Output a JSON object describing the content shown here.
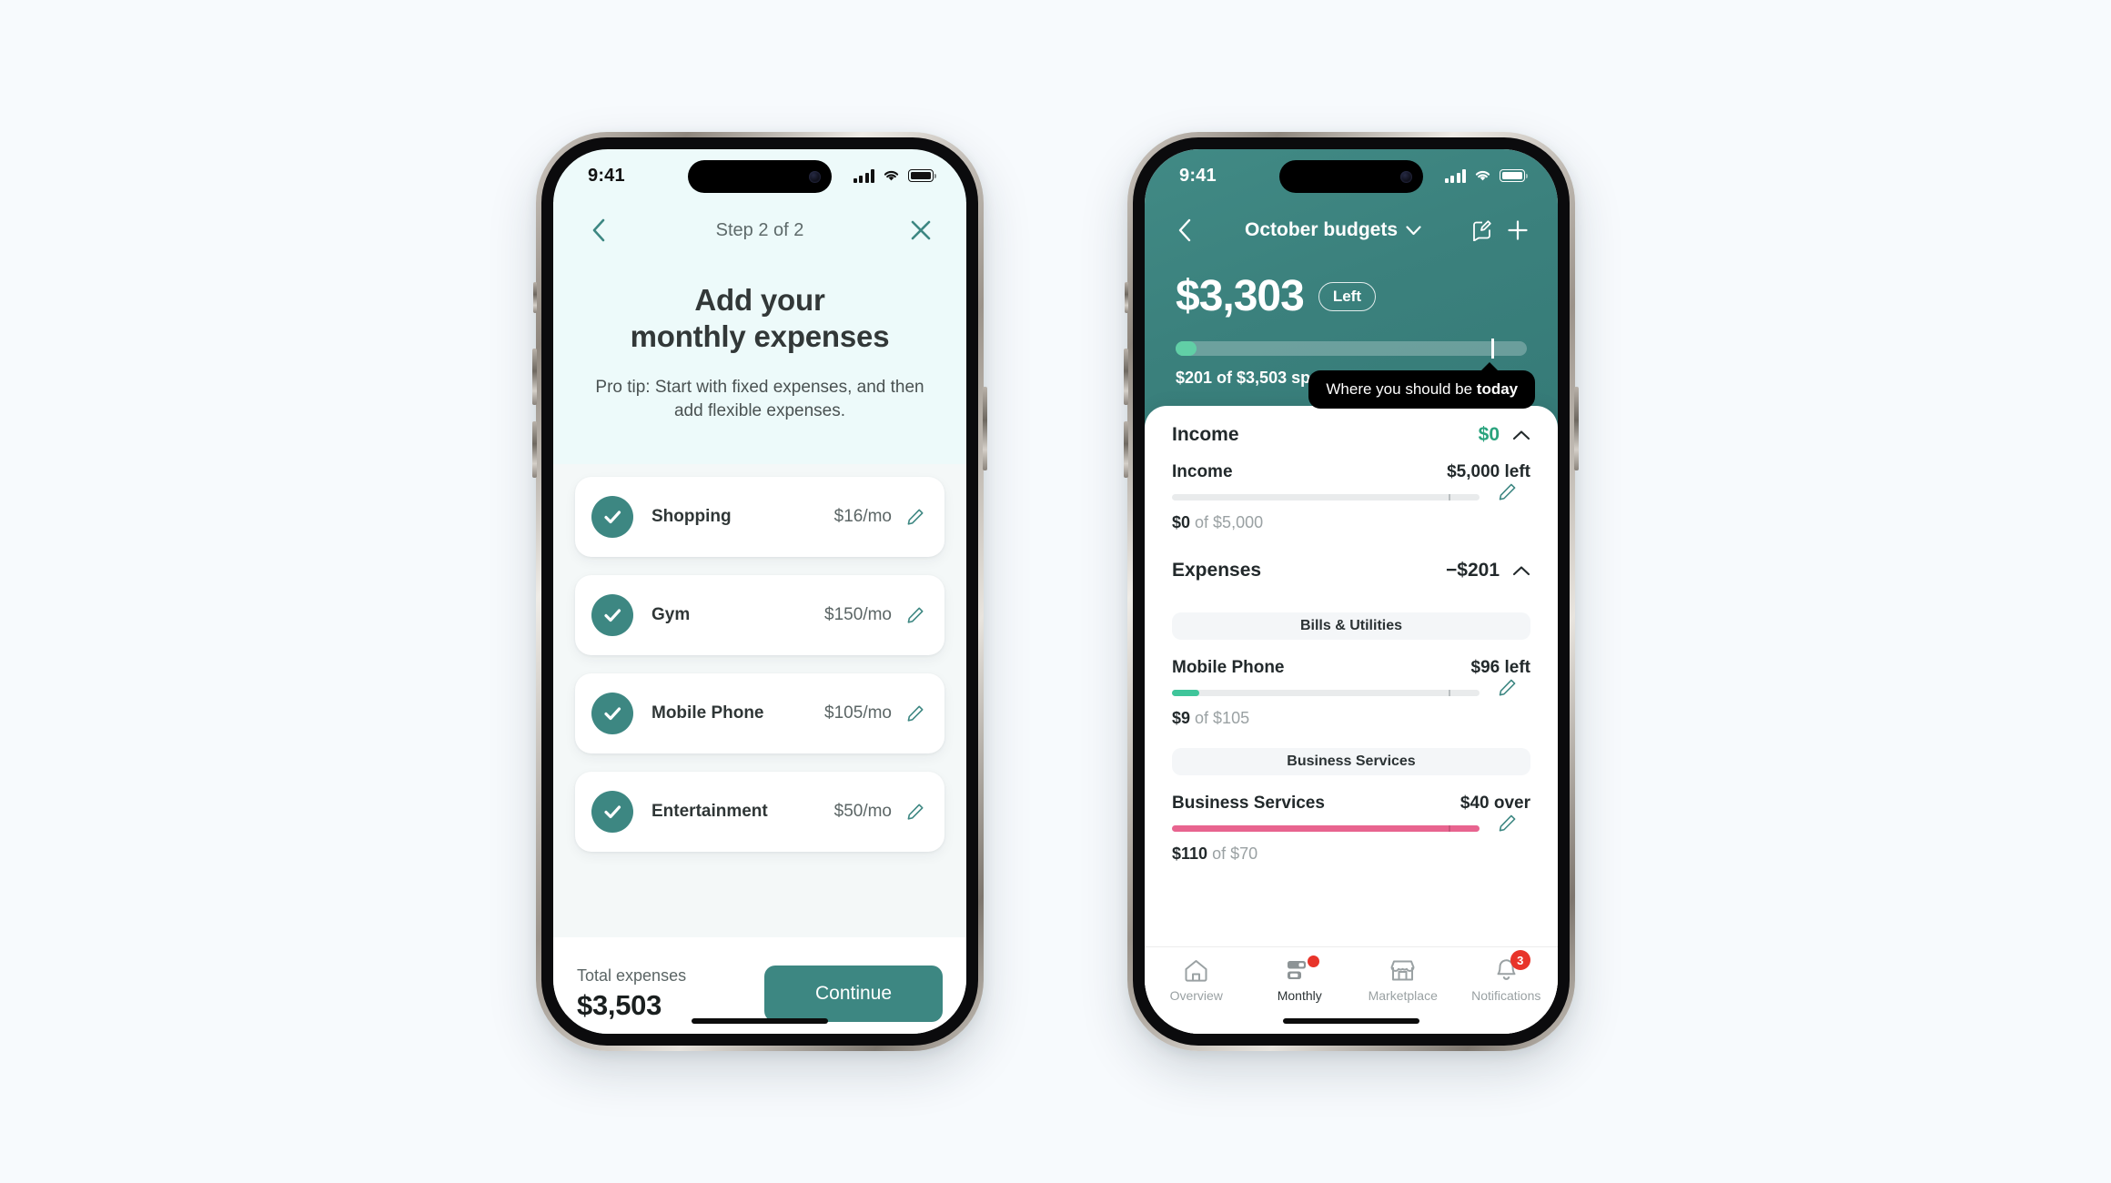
{
  "theme": {
    "teal": "#3d8782",
    "mint_bg": "#edfafa",
    "page_bg": "#f7fafd",
    "green": "#2aa37e",
    "bar_green": "#61cfa6",
    "pink": "#e8648f",
    "red": "#e8342a"
  },
  "phone1": {
    "status": {
      "time": "9:41",
      "signal_icon": "signal-bars-icon",
      "wifi_icon": "wifi-icon",
      "battery_icon": "battery-full-icon"
    },
    "nav": {
      "back_icon": "chevron-left-icon",
      "title": "Step 2 of 2",
      "close_icon": "close-x-icon"
    },
    "hero": {
      "title_line1": "Add your",
      "title_line2": "monthly expenses",
      "subtitle": "Pro tip: Start with fixed expenses, and then add flexible expenses."
    },
    "expenses": [
      {
        "name": "Shopping",
        "amount": "$16/mo",
        "checked": true,
        "edit_icon": "pencil-icon"
      },
      {
        "name": "Gym",
        "amount": "$150/mo",
        "checked": true,
        "edit_icon": "pencil-icon"
      },
      {
        "name": "Mobile Phone",
        "amount": "$105/mo",
        "checked": true,
        "edit_icon": "pencil-icon"
      },
      {
        "name": "Entertainment",
        "amount": "$50/mo",
        "checked": true,
        "edit_icon": "pencil-icon"
      }
    ],
    "footer": {
      "total_label": "Total expenses",
      "total_value": "$3,503",
      "continue_label": "Continue"
    }
  },
  "phone2": {
    "status": {
      "time": "9:41",
      "signal_icon": "signal-bars-icon",
      "wifi_icon": "wifi-icon",
      "battery_icon": "battery-full-icon"
    },
    "nav": {
      "back_icon": "chevron-left-icon",
      "title": "October budgets",
      "title_chevron_icon": "chevron-down-icon",
      "edit_icon": "edit-note-icon",
      "add_icon": "plus-icon"
    },
    "balance": {
      "amount": "$3,303",
      "pill": "Left",
      "spent_line": "$201 of $3,503 spent",
      "progress_percent": 6,
      "today_marker_percent": 90
    },
    "tooltip": {
      "prefix": "Where you should be ",
      "bold": "today"
    },
    "income_section": {
      "title": "Income",
      "amount": "$0",
      "chevron_icon": "chevron-up-icon",
      "rows": [
        {
          "name": "Income",
          "right": "$5,000 left",
          "sub_bold": "$0",
          "sub_rest": " of $5,000",
          "fill_percent": 0,
          "fill_color": "#2aa37e",
          "tick_percent": 90,
          "edit_icon": "pencil-icon"
        }
      ]
    },
    "expenses_section": {
      "title": "Expenses",
      "amount": "−$201",
      "chevron_icon": "chevron-up-icon",
      "categories": [
        {
          "chip": "Bills & Utilities",
          "rows": [
            {
              "name": "Mobile Phone",
              "right": "$96 left",
              "sub_bold": "$9",
              "sub_rest": " of $105",
              "fill_percent": 9,
              "fill_color": "#3fc59a",
              "tick_percent": 90,
              "edit_icon": "pencil-icon"
            }
          ]
        },
        {
          "chip": "Business Services",
          "rows": [
            {
              "name": "Business Services",
              "right": "$40 over",
              "sub_bold": "$110",
              "sub_rest": " of $70",
              "fill_percent": 100,
              "fill_color": "#e8648f",
              "tick_percent": 90,
              "edit_icon": "pencil-icon"
            }
          ]
        }
      ]
    },
    "tabs": [
      {
        "label": "Overview",
        "icon": "home-icon",
        "active": false,
        "dot": false,
        "badge": null
      },
      {
        "label": "Monthly",
        "icon": "budget-bars-icon",
        "active": true,
        "dot": true,
        "badge": null
      },
      {
        "label": "Marketplace",
        "icon": "storefront-icon",
        "active": false,
        "dot": false,
        "badge": null
      },
      {
        "label": "Notifications",
        "icon": "bell-icon",
        "active": false,
        "dot": false,
        "badge": "3"
      }
    ]
  }
}
